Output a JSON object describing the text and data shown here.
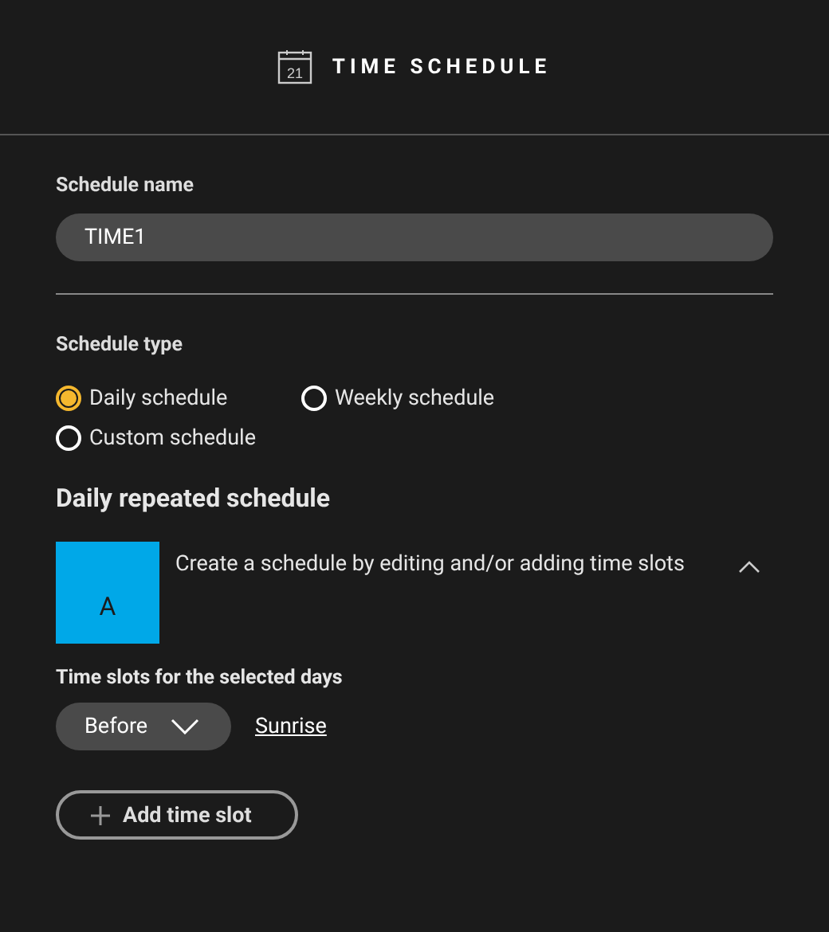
{
  "header": {
    "icon_day": "21",
    "title": "TIME SCHEDULE"
  },
  "schedule_name": {
    "label": "Schedule name",
    "value": "TIME1"
  },
  "schedule_type": {
    "label": "Schedule type",
    "options": [
      {
        "label": "Daily schedule",
        "selected": true
      },
      {
        "label": "Weekly schedule",
        "selected": false
      },
      {
        "label": "Custom schedule",
        "selected": false
      }
    ]
  },
  "section_title": "Daily repeated schedule",
  "slot_card": {
    "tile": "A",
    "color": "#00a8e8",
    "description": "Create a schedule by editing and/or adding time slots",
    "expanded": true
  },
  "time_slots": {
    "label": "Time slots for the selected days",
    "relation": "Before",
    "event": "Sunrise"
  },
  "add_button": "Add time slot"
}
